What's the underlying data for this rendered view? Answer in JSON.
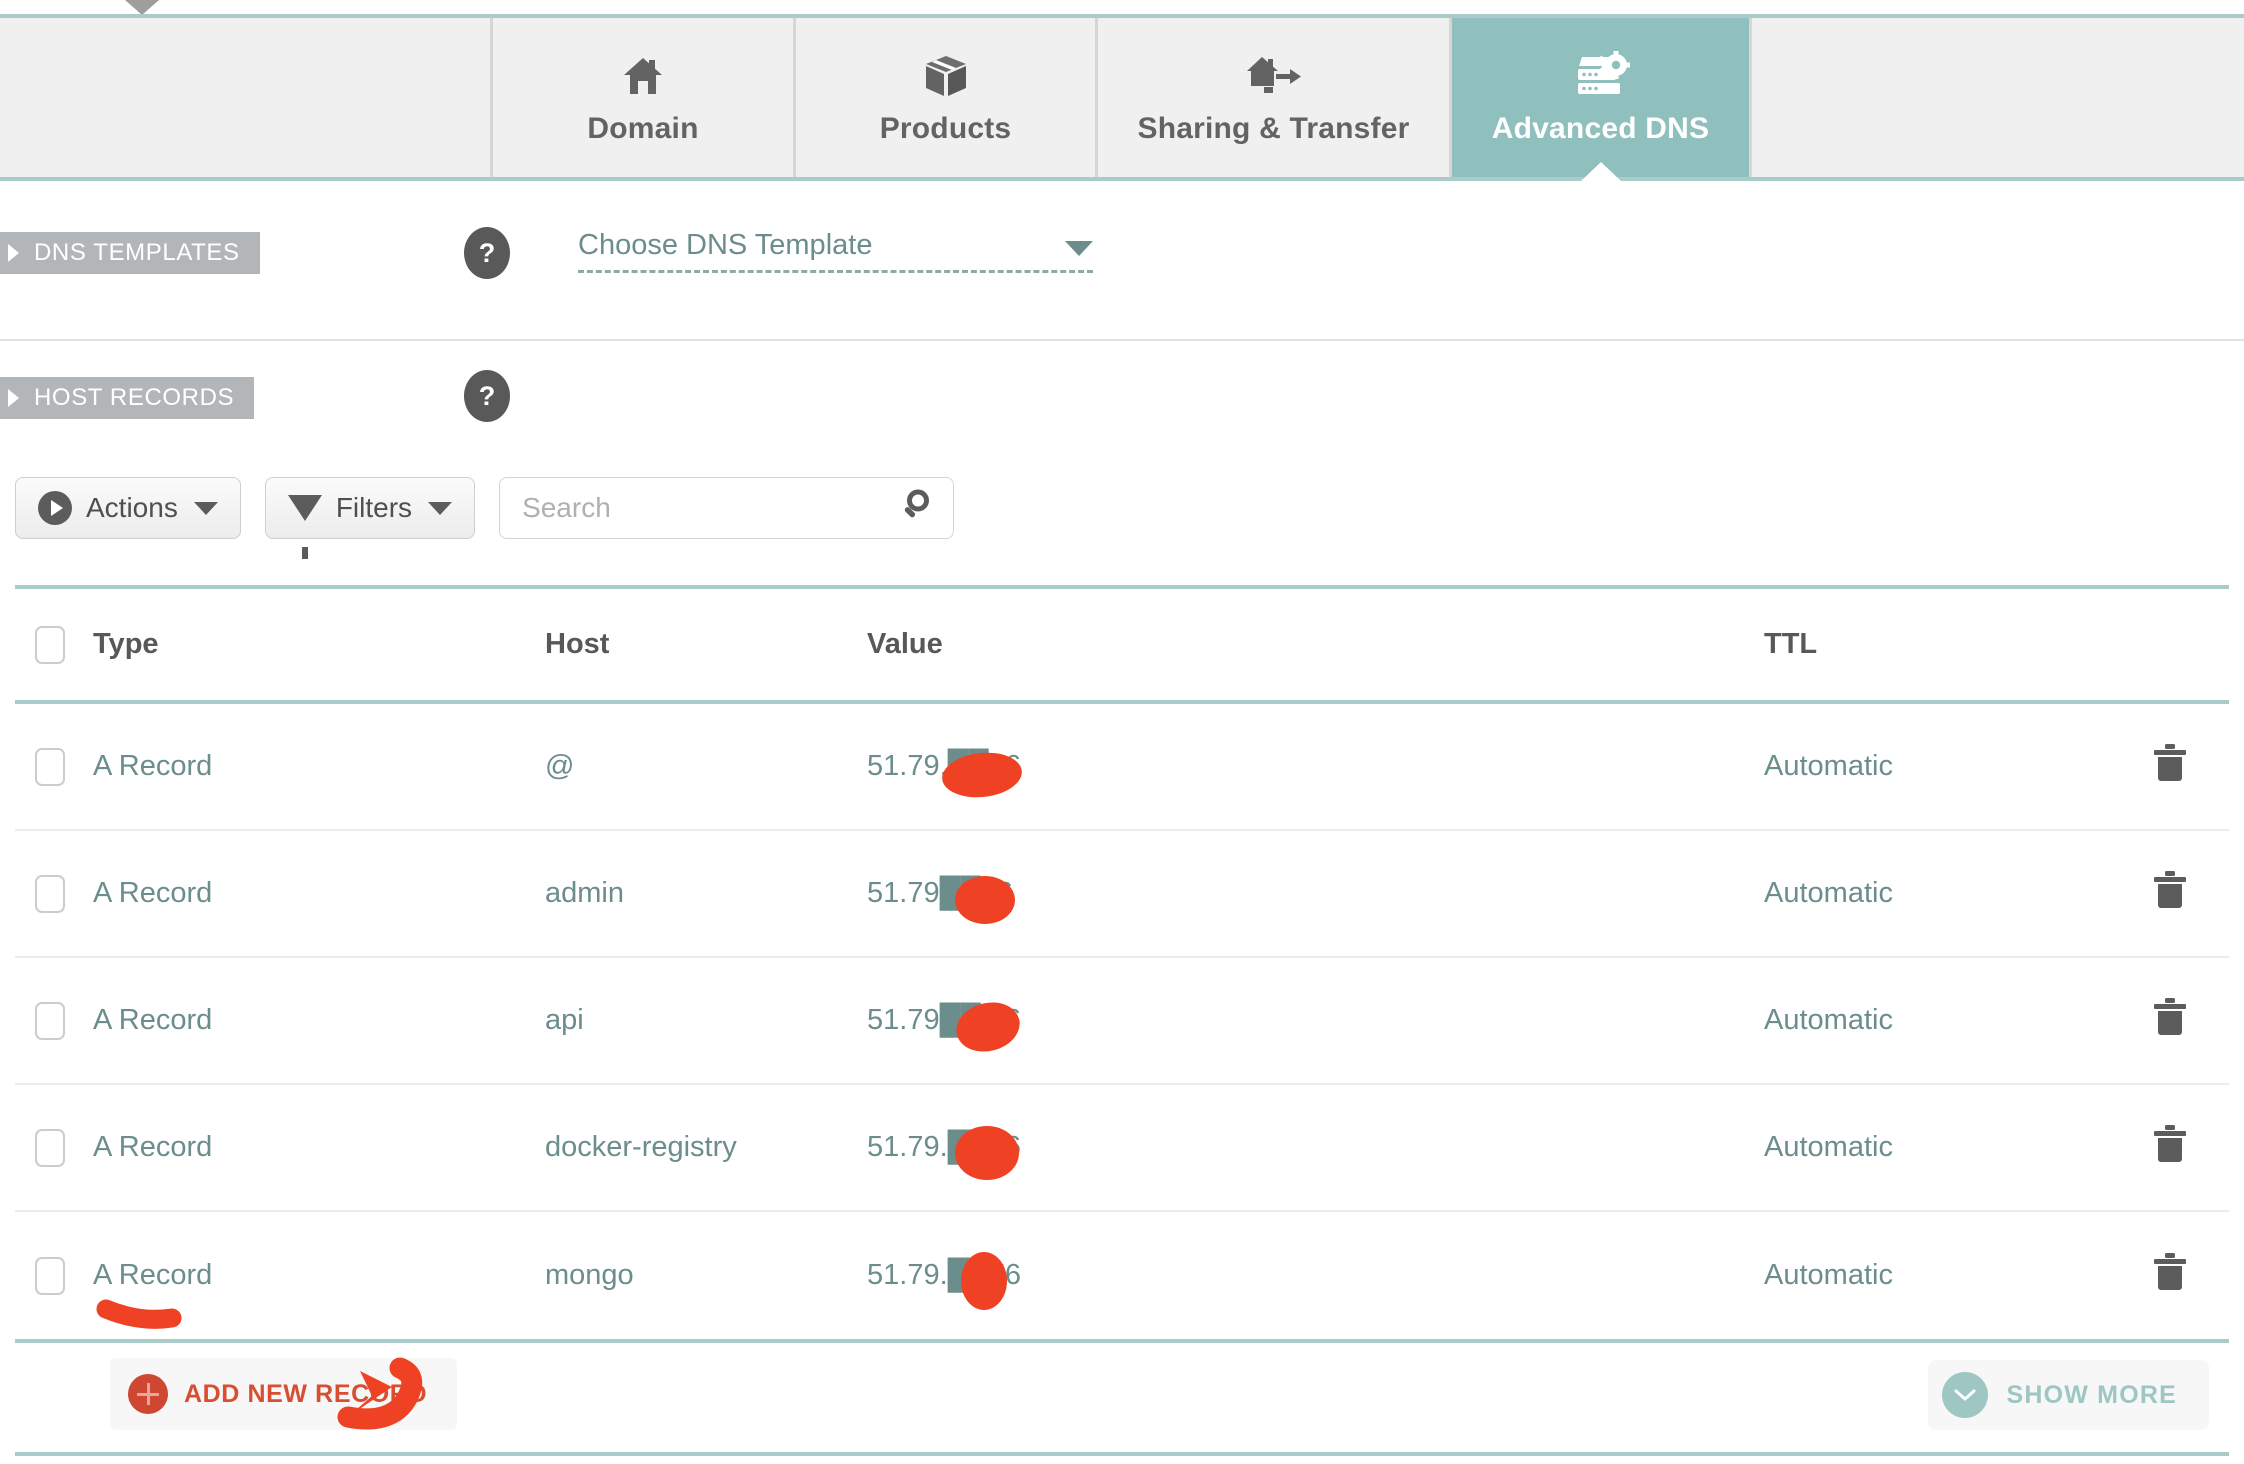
{
  "tabs": [
    {
      "label": "Domain",
      "icon": "home-icon",
      "active": false
    },
    {
      "label": "Products",
      "icon": "box-icon",
      "active": false
    },
    {
      "label": "Sharing & Transfer",
      "icon": "home-arrow-icon",
      "active": false
    },
    {
      "label": "Advanced DNS",
      "icon": "server-gear-icon",
      "active": true
    }
  ],
  "sections": {
    "dns_templates": {
      "tag_label": "DNS TEMPLATES",
      "help_label": "?",
      "select_value": "Choose DNS Template"
    },
    "host_records": {
      "tag_label": "HOST RECORDS",
      "help_label": "?"
    }
  },
  "toolbar": {
    "actions_label": "Actions",
    "filters_label": "Filters",
    "search_placeholder": "Search",
    "search_value": ""
  },
  "table": {
    "columns": [
      "Type",
      "Host",
      "Value",
      "TTL"
    ],
    "rows": [
      {
        "type": "A Record",
        "host": "@",
        "value": "51.79.██76",
        "ttl": "Automatic"
      },
      {
        "type": "A Record",
        "host": "admin",
        "value": "51.79██76",
        "ttl": "Automatic"
      },
      {
        "type": "A Record",
        "host": "api",
        "value": "51.79██.76",
        "ttl": "Automatic"
      },
      {
        "type": "A Record",
        "host": "docker-registry",
        "value": "51.79.██76",
        "ttl": "Automatic"
      },
      {
        "type": "A Record",
        "host": "mongo",
        "value": "51.79.██76",
        "ttl": "Automatic"
      }
    ],
    "value_prefix": "51.79.",
    "value_suffix": "76",
    "delete_icon": "trash-icon",
    "checkbox_icon": "checkbox-icon"
  },
  "footer": {
    "add_record_label": "ADD NEW RECORD",
    "add_record_icon": "plus-circle-icon",
    "show_more_label": "SHOW MORE",
    "show_more_icon": "chevron-down-icon"
  },
  "colors": {
    "teal": "#8fc0bd",
    "teal_rule": "#a9cbc9",
    "teal_text": "#6b8d8b",
    "tab_bg": "#f0f0f0",
    "tag_gray": "#b3b6b8",
    "annotation_red": "#ef4123",
    "add_record_red": "#d94e31",
    "header_text": "#585858"
  },
  "annotations": {
    "redaction_label": "redacted-ip-blob",
    "underline_label": "red-underline-a-record",
    "arrow_label": "red-arrow-to-add-new-record"
  }
}
